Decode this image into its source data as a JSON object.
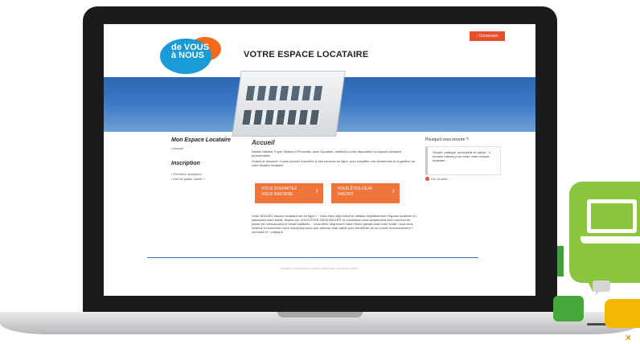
{
  "site": {
    "logo": {
      "line1": "de VOUS",
      "line2": "à NOUS"
    },
    "title": "VOTRE ESPACE LOCATAIRE",
    "login_label": "› Connexion"
  },
  "sidebar": {
    "section1_title": "Mon Espace Locataire",
    "section1_items": [
      "• Accueil"
    ],
    "section2_title": "Inscription",
    "section2_items": [
      "• Première inscription",
      "• Mot de passe oublié ?"
    ]
  },
  "main": {
    "heading": "Accueil",
    "intro": "Alliade Habitat, Foyer Vellave et Promélia, avec Equatum, mettent à votre disposition un espace locataire personnalisé.",
    "intro2": "Gratuit et sécurisé, il vous permet d'accéder à des services en ligne, pour simplifier vos démarches et la gestion de votre dossier locataire.",
    "cta_register": "VOUS SOUHAITEZ VOUS INSCRIRE",
    "cta_registered": "VOUS ÊTES DÉJÀ INSCRIT",
    "notice": "Votre NOUVEL espace locataire est en ligne ! - Vous étiez déjà inscrit et utilisiez régulièrement l'espace locataire en saisissant votre email, cliquez sur VOUS ÊTES DÉJÀ INSCRIT et connectez-vous simplement avec vos mot de passe (en minuscules) et email habituels. - Vous étiez déjà inscrit mais n'avez jamais saisi votre email, nous vous invitons à renouveler votre inscription avec une adresse mail valide pour bénéficier de ce nouvel environnement + convivial et + pratique."
  },
  "aside": {
    "title": "Pourquoi vous inscrire ?",
    "box": "Simple, pratique, accessible et rapide : 4 bonnes raisons pour créer votre compte locataire...",
    "link": "Lire la suite..."
  },
  "footer": {
    "text": "Copyright © 2016 Extranet Locataires Sitara Group. Tous droits réservés."
  },
  "colors": {
    "brand_blue": "#1a9ad6",
    "brand_orange": "#f26b1d",
    "cta": "#f0753b",
    "accent_green": "#8cc63f"
  }
}
